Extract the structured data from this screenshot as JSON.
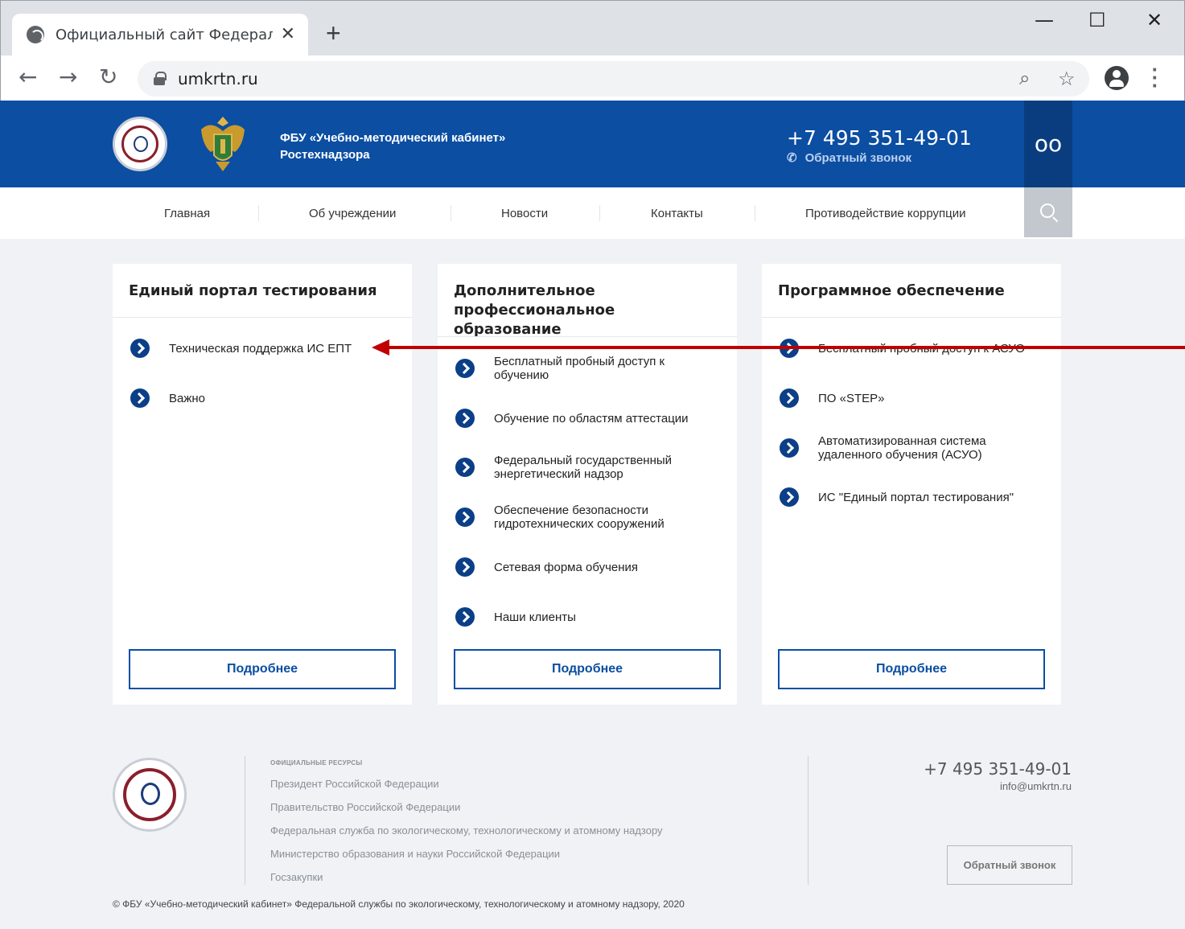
{
  "browser": {
    "tab_title": "Официальный сайт Федеральнс",
    "tab_close": "✕",
    "new_tab": "+",
    "url": "umkrtn.ru",
    "window_minimize": "—",
    "window_maximize": "☐",
    "window_close": "✕"
  },
  "header": {
    "brand_line1": "ФБУ «Учебно-методический кабинет»",
    "brand_line2": "Ростехнадзора",
    "phone": "+7 495 351-49-01",
    "callback": "Обратный звонок",
    "accessibility_icon": "oo"
  },
  "nav": {
    "items": [
      "Главная",
      "Об учреждении",
      "Новости",
      "Контакты",
      "Противодействие коррупции"
    ]
  },
  "cards": [
    {
      "title": "Единый портал тестирования",
      "items": [
        "Техническая поддержка ИС ЕПТ",
        "Важно"
      ],
      "button": "Подробнее"
    },
    {
      "title": "Дополнительное профессиональное образование",
      "items": [
        "Бесплатный пробный доступ к обучению",
        "Обучение по областям аттестации",
        "Федеральный государственный энергетический надзор",
        "Обеспечение безопасности гидротехнических сооружений",
        "Сетевая форма обучения",
        "Наши клиенты"
      ],
      "button": "Подробнее"
    },
    {
      "title": "Программное обеспечение",
      "items": [
        "Бесплатный пробный доступ к АСУО",
        "ПО «STEP»",
        "Автоматизированная система удаленного обучения (АСУО)",
        "ИС \"Единый портал тестирования\""
      ],
      "button": "Подробнее"
    }
  ],
  "footer": {
    "resources_heading": "ОФИЦИАЛЬНЫЕ РЕСУРСЫ",
    "resources": [
      "Президент Российской Федерации",
      "Правительство Российской Федерации",
      "Федеральная служба по экологическому, технологическому и атомному надзору",
      "Министерство образования и науки Российской Федерации",
      "Госзакупки"
    ],
    "phone": "+7 495 351-49-01",
    "email": "info@umkrtn.ru",
    "callback_button": "Обратный звонок",
    "copyright": "© ФБУ «Учебно-методический кабинет» Федеральной службы по экологическому, технологическому и атомному надзору, 2020"
  },
  "colors": {
    "brand_blue": "#0b4ea2",
    "annotation_red": "#c00000"
  }
}
